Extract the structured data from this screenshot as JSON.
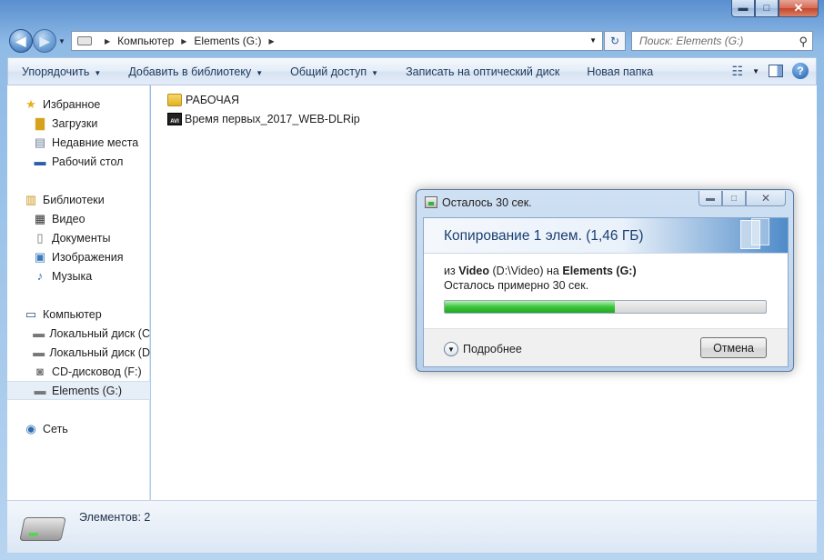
{
  "window": {
    "caption_buttons": {
      "minimize": "▬",
      "maximize": "□",
      "close": "✕"
    }
  },
  "address": {
    "crumbs": [
      "Компьютер",
      "Elements (G:)"
    ],
    "search_placeholder": "Поиск: Elements (G:)"
  },
  "toolbar": {
    "organize": "Упорядочить",
    "add_to_library": "Добавить в библиотеку",
    "share": "Общий доступ",
    "burn": "Записать на оптический диск",
    "new_folder": "Новая папка"
  },
  "sidebar": {
    "favorites": "Избранное",
    "downloads": "Загрузки",
    "recent": "Недавние места",
    "desktop": "Рабочий стол",
    "libraries": "Библиотеки",
    "video": "Видео",
    "documents": "Документы",
    "images": "Изображения",
    "music": "Музыка",
    "computer": "Компьютер",
    "local_c": "Локальный диск (C",
    "local_d": "Локальный диск (D",
    "cd": "CD-дисковод (F:)",
    "elements": "Elements (G:)",
    "network": "Сеть"
  },
  "files": [
    {
      "name": "РАБОЧАЯ",
      "type": "folder"
    },
    {
      "name": "Время первых_2017_WEB-DLRip",
      "type": "video"
    }
  ],
  "status": {
    "items": "Элементов: 2"
  },
  "dialog": {
    "title": "Осталось 30 сек.",
    "heading": "Копирование 1 элем. (1,46 ГБ)",
    "from_prefix": "из",
    "source": "Video",
    "source_path": "(D:\\Video)",
    "to_word": "на",
    "dest": "Elements (G:)",
    "remaining": "Осталось примерно 30 сек.",
    "progress": 0.53,
    "more": "Подробнее",
    "cancel": "Отмена"
  }
}
